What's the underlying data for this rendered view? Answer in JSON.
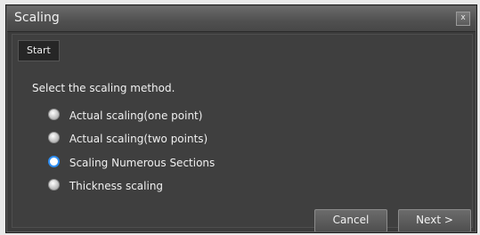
{
  "window": {
    "title": "Scaling",
    "close_glyph": "x"
  },
  "tab": {
    "label": "Start"
  },
  "prompt": "Select the scaling method.",
  "options": [
    {
      "label": "Actual scaling(one point)",
      "selected": false
    },
    {
      "label": "Actual scaling(two points)",
      "selected": false
    },
    {
      "label": "Scaling Numerous Sections",
      "selected": true
    },
    {
      "label": "Thickness scaling",
      "selected": false
    }
  ],
  "buttons": {
    "cancel": "Cancel",
    "next": "Next >"
  },
  "colors": {
    "accent": "#2f8ff3",
    "background": "#3f3f3f"
  }
}
